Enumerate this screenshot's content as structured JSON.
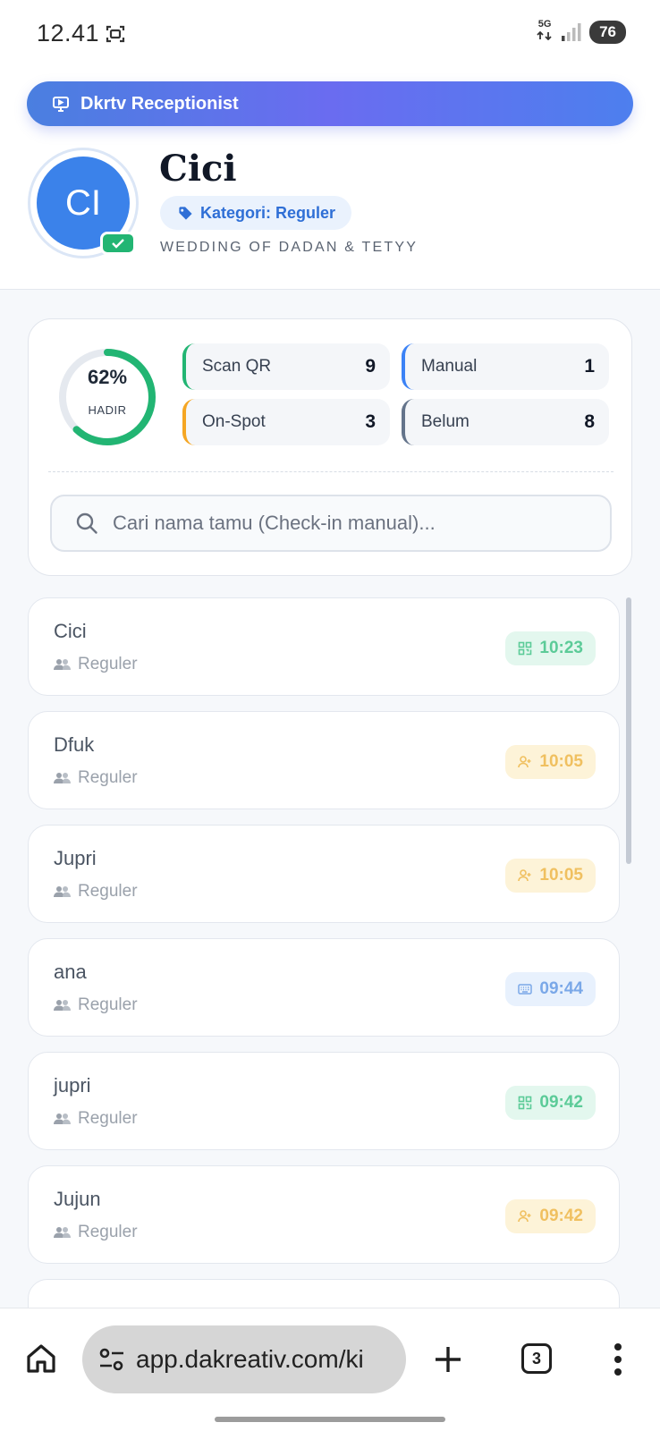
{
  "status_bar": {
    "time": "12.41",
    "network": "5G",
    "battery": "76"
  },
  "header": {
    "app_title": "Dkrtv Receptionist",
    "avatar_initials": "CI",
    "guest_name": "Cici",
    "category_badge": "Kategori: Reguler",
    "event": "WEDDING OF DADAN & TETYY"
  },
  "stats": {
    "attendance_percent_label": "62%",
    "attendance_fraction": 0.62,
    "attendance_caption": "HADIR",
    "items": [
      {
        "label": "Scan QR",
        "value": "9"
      },
      {
        "label": "Manual",
        "value": "1"
      },
      {
        "label": "On-Spot",
        "value": "3"
      },
      {
        "label": "Belum",
        "value": "8"
      }
    ],
    "colors": {
      "qr": "#22b573",
      "manual": "#3b82f6",
      "onspot": "#f5a623",
      "belum": "#64748b"
    }
  },
  "search": {
    "placeholder": "Cari nama tamu (Check-in manual)...",
    "value": ""
  },
  "guests": [
    {
      "name": "Cici",
      "category": "Reguler",
      "method": "qr",
      "time": "10:23"
    },
    {
      "name": "Dfuk",
      "category": "Reguler",
      "method": "onspot",
      "time": "10:05"
    },
    {
      "name": "Jupri",
      "category": "Reguler",
      "method": "onspot",
      "time": "10:05"
    },
    {
      "name": "ana",
      "category": "Reguler",
      "method": "manual",
      "time": "09:44"
    },
    {
      "name": "jupri",
      "category": "Reguler",
      "method": "qr",
      "time": "09:42"
    },
    {
      "name": "Jujun",
      "category": "Reguler",
      "method": "onspot",
      "time": "09:42"
    }
  ],
  "browser": {
    "url": "app.dakreativ.com/ki",
    "tab_count": "3"
  },
  "icons": {
    "status": "screenshot-icon",
    "header": "tv-icon",
    "badge": "tag-icon",
    "search": "search-icon",
    "qr": "qr-icon",
    "onspot": "user-plus-icon",
    "manual": "keyboard-icon",
    "category": "users-icon"
  }
}
